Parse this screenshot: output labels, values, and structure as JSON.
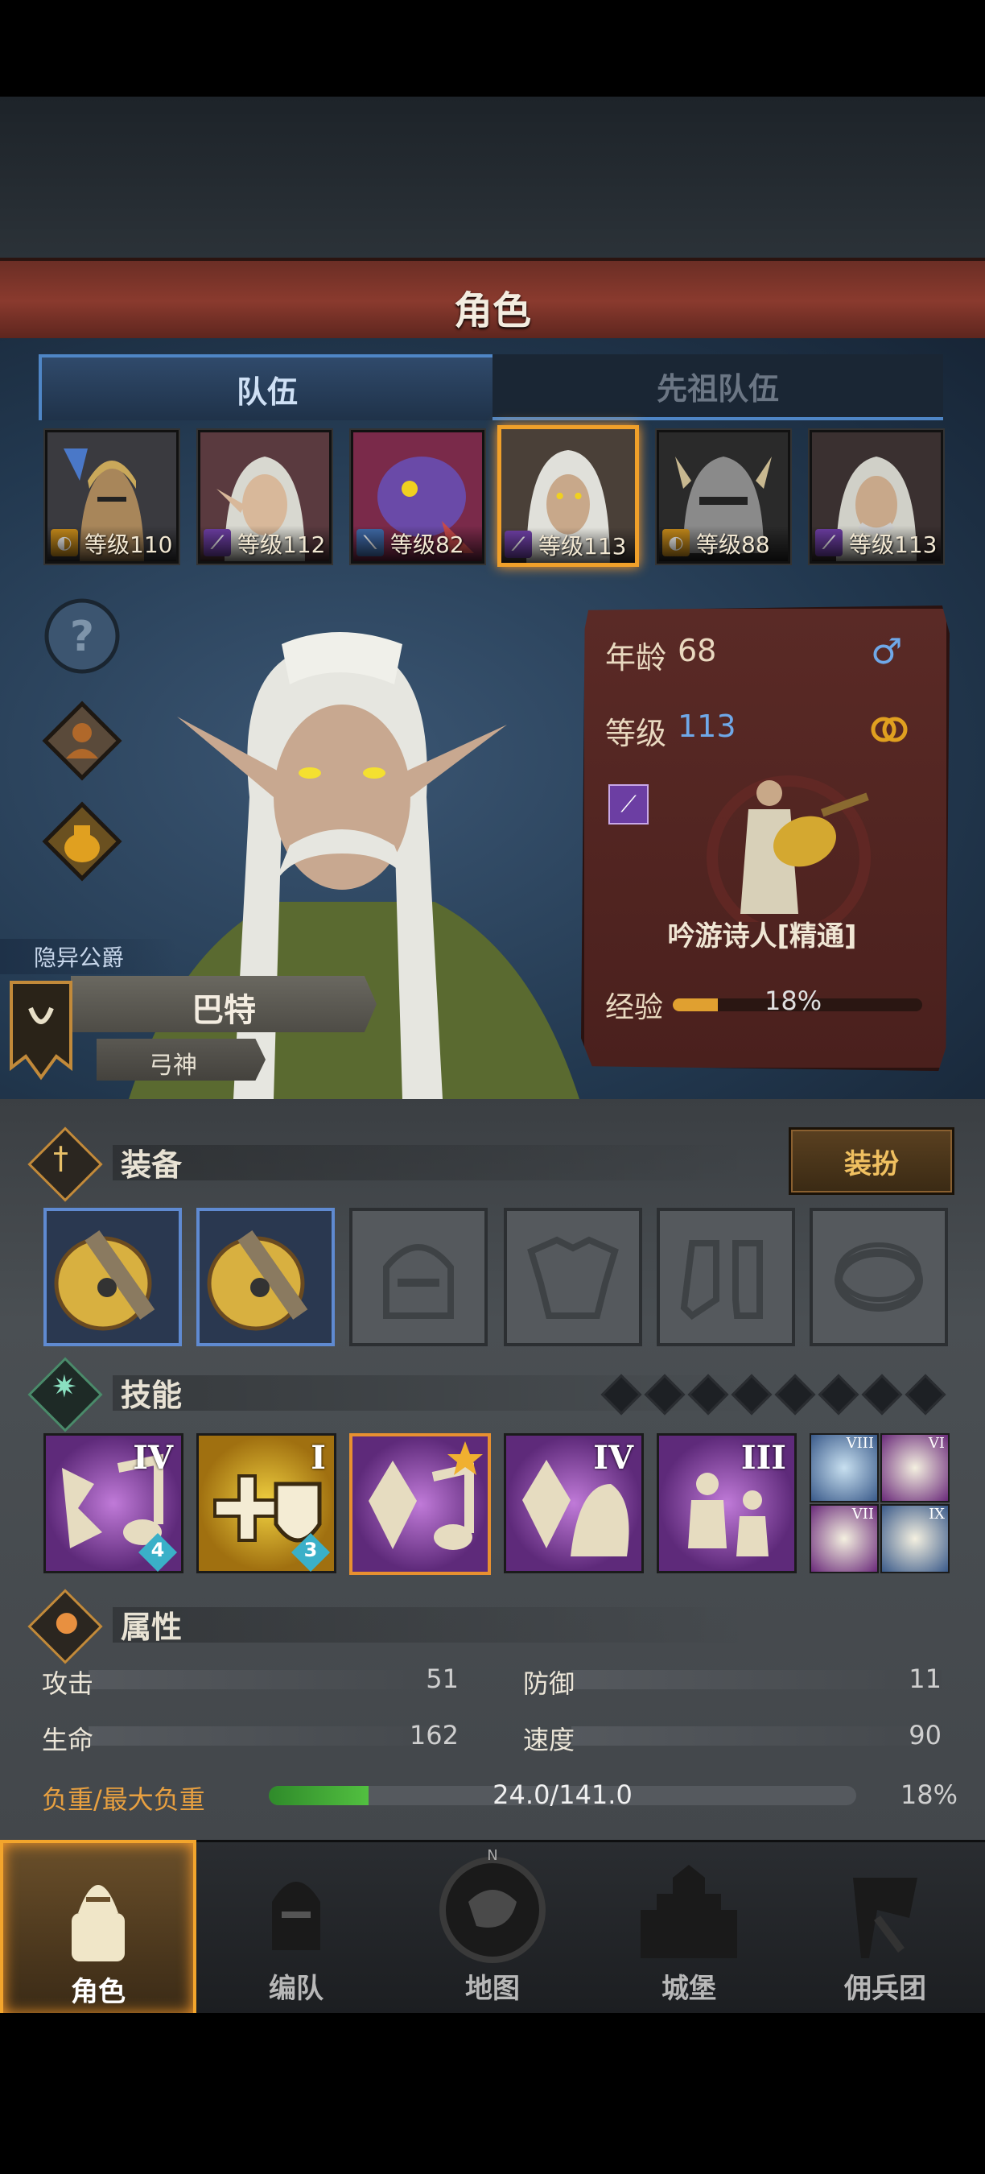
{
  "header": {
    "title": "角色"
  },
  "tabs": [
    {
      "label": "队伍",
      "active": true
    },
    {
      "label": "先祖队伍",
      "active": false
    }
  ],
  "roster": [
    {
      "level_text": "等级110",
      "class_icon": "shield-class-icon",
      "class_color": "gold"
    },
    {
      "level_text": "等级112",
      "class_icon": "staff-class-icon",
      "class_color": "purple"
    },
    {
      "level_text": "等级82",
      "class_icon": "sword-class-icon",
      "class_color": "blue"
    },
    {
      "level_text": "等级113",
      "class_icon": "staff-class-icon",
      "class_color": "purple",
      "selected": true
    },
    {
      "level_text": "等级88",
      "class_icon": "shield-class-icon",
      "class_color": "gold"
    },
    {
      "level_text": "等级113",
      "class_icon": "staff-class-icon",
      "class_color": "purple"
    }
  ],
  "character": {
    "title": "隐异公爵",
    "name": "巴特",
    "subtitle": "弓神",
    "age_label": "年龄",
    "age": "68",
    "level_label": "等级",
    "level": "113",
    "class_name": "吟游诗人[精通]",
    "exp_label": "经验",
    "exp_percent": "18%",
    "exp_fraction": 0.18
  },
  "equipment": {
    "title": "装备",
    "dress_button": "装扮",
    "slots": [
      "lute",
      "lute",
      "helmet",
      "armor",
      "boots",
      "ring"
    ]
  },
  "skills": {
    "title": "技能",
    "big": [
      {
        "roman": "IV",
        "badge": "4"
      },
      {
        "roman": "I",
        "badge": "3"
      },
      {
        "roman": "",
        "badge": ""
      },
      {
        "roman": "IV",
        "badge": ""
      },
      {
        "roman": "III",
        "badge": ""
      }
    ],
    "small": [
      "VIII",
      "VI",
      "VII",
      "IX"
    ]
  },
  "attributes": {
    "title": "属性",
    "attack_label": "攻击",
    "attack": "51",
    "defense_label": "防御",
    "defense": "11",
    "hp_label": "生命",
    "hp": "162",
    "speed_label": "速度",
    "speed": "90",
    "load_label": "负重/最大负重",
    "load": "24.0/141.0",
    "load_percent": "18%",
    "load_fraction": 0.17
  },
  "nav": [
    {
      "label": "角色",
      "active": true
    },
    {
      "label": "编队",
      "active": false
    },
    {
      "label": "地图",
      "active": false
    },
    {
      "label": "城堡",
      "active": false
    },
    {
      "label": "佣兵团",
      "active": false
    }
  ],
  "colors": {
    "accent": "#f3a52c",
    "panel": "#4a201d",
    "blue": "#4f86c6"
  }
}
